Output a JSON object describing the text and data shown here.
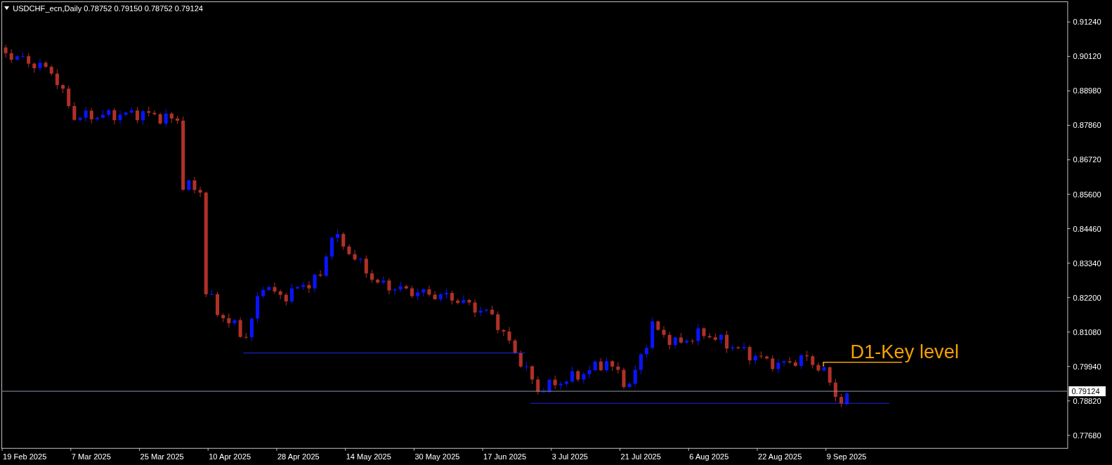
{
  "header": {
    "symbol": "USDCHF_ecn,Daily",
    "quotes": [
      "0.78752",
      "0.79150",
      "0.78752",
      "0.79124"
    ]
  },
  "price_axis": [
    "0.91240",
    "0.90120",
    "0.88980",
    "0.87860",
    "0.86720",
    "0.85600",
    "0.84460",
    "0.83340",
    "0.82200",
    "0.81080",
    "0.79940",
    "0.78820",
    "0.77680"
  ],
  "current_price": "0.79124",
  "date_axis": [
    "19 Feb 2025",
    "7 Mar 2025",
    "25 Mar 2025",
    "10 Apr 2025",
    "28 Apr 2025",
    "14 May 2025",
    "30 May 2025",
    "17 Jun 2025",
    "3 Jul 2025",
    "21 Jul 2025",
    "6 Aug 2025",
    "22 Aug 2025",
    "9 Sep 2025"
  ],
  "annotation": "D1-Key level"
}
